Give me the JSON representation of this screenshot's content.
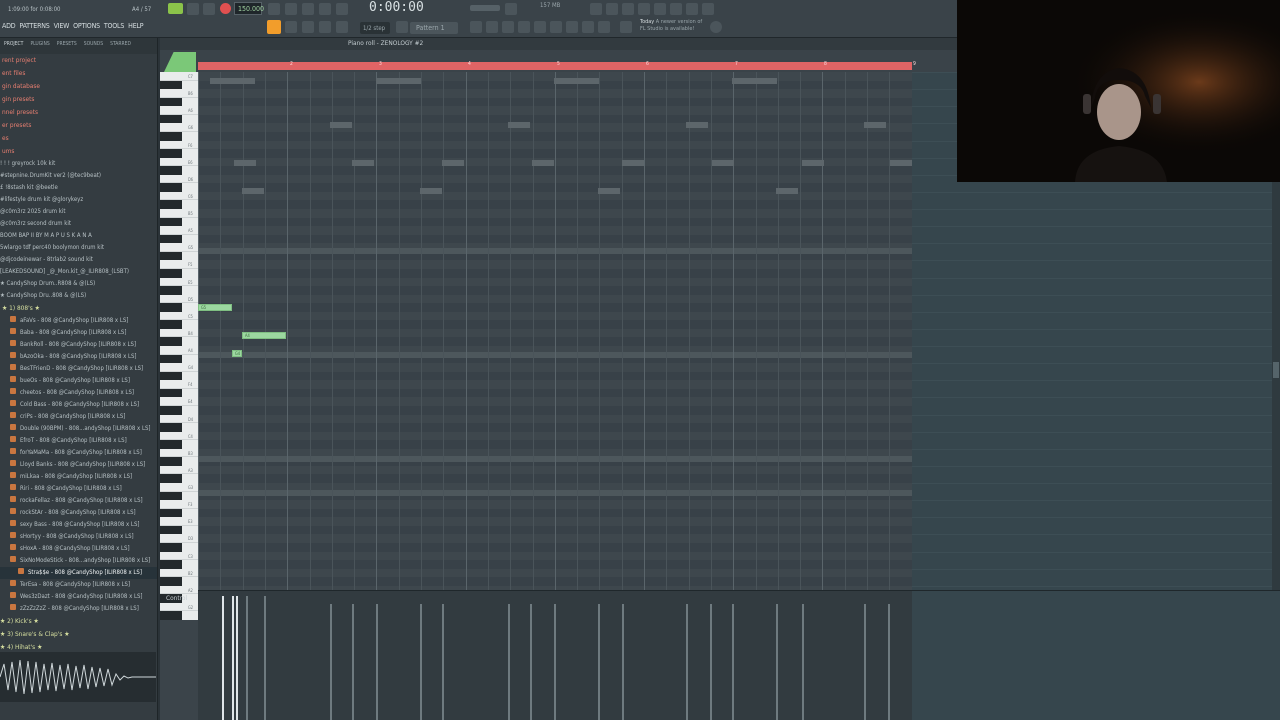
{
  "toolbar": {
    "hint_left": "1:09:00 for 0:08:00",
    "hint_right": "A4 / 57",
    "tempo": "150.000",
    "time": "0:00:00",
    "menu": [
      "ADD",
      "PATTERNS",
      "VIEW",
      "OPTIONS",
      "TOOLS",
      "HELP"
    ],
    "step": "1/2 step",
    "pattern": "Pattern 1",
    "cpu": "157 MB",
    "news_day": "Today",
    "news_text": "A newer version of",
    "news_text2": "FL Studio is available!"
  },
  "browser": {
    "tabs": [
      "PROJECT",
      "PLUGINS",
      "PRESETS",
      "SOUNDS",
      "STARRED"
    ],
    "top_items": [
      "rent project",
      "ent files",
      "gin database",
      "gin presets",
      "nnel presets",
      "er presets",
      "es"
    ],
    "section": "ums",
    "kits": [
      "! ! ! greyrock 10k kit",
      "#stepnine.DrumKit ver2 (@tec9beat)",
      "£ !8stash kit @beetle",
      "#lifestyle drum kit @glorykeyz",
      "@c0m3rz 2025 drum kit",
      "@c0m3rz second drum kit",
      "BOOM BAP II BY M A P U S K A N A",
      "5wlargo tdf perc40 boolymon drum kit",
      "@djcodeinewar - 8trlab2 sound kit",
      "[LEAKEDSOUND] _@_Mon.kit_@_ILIR808_(LSBT)"
    ],
    "candy_folders": [
      "★ CandyShop Drum..R808 & @(LS)",
      "★ CandyShop Dru..808 & @(LS)"
    ],
    "folder_808": "★ 1) 808's ★",
    "samples": [
      "aFaVs - 808 @CandyShop [ILIR808 x LS]",
      "Baba - 808 @CandyShop [ILIR808 x LS]",
      "BankRoll - 808 @CandyShop [ILIR808 x LS]",
      "bAzoOka - 808 @CandyShop [ILIR808 x LS]",
      "BesTFrienD - 808 @CandyShop [ILIR808 x LS]",
      "bueOs - 808 @CandyShop [ILIR808 x LS]",
      "cheetos - 808 @CandyShop [ILIR808 x LS]",
      "Cold Bass - 808 @CandyShop [ILIR808 x LS]",
      "criPs - 808 @CandyShop [ILIR808 x LS]",
      "Double (90BPM) - 808...andyShop [ILIR808 x LS]",
      "EfroT - 808 @CandyShop [ILIR808 x LS]",
      "forYaMaMa - 808 @CandyShop [ILIR808 x LS]",
      "Lloyd Banks - 808 @CandyShop [ILIR808 x LS]",
      "miLkaa - 808 @CandyShop [ILIR808 x LS]",
      "Riri - 808 @CandyShop [ILIR808 x LS]",
      "rockaFellaz - 808 @CandyShop [ILIR808 x LS]",
      "rockStAr - 808 @CandyShop [ILIR808 x LS]",
      "sexy Bass - 808 @CandyShop [ILIR808 x LS]",
      "sHortyy - 808 @CandyShop [ILIR808 x LS]",
      "sHoxA - 808 @CandyShop [ILIR808 x LS]",
      "SixNoModeStick - 808...andyShop [ILIR808 x LS]",
      "Stra$$e - 808 @CandyShop [ILIR808 x LS]",
      "TerEsa - 808 @CandyShop [ILIR808 x LS]",
      "Wes3zDazt - 808 @CandyShop [ILIR808 x LS]",
      "zZzZzZzZ - 808 @CandyShop [ILIR808 x LS]"
    ],
    "selected_sample_index": 21,
    "folder_kicks": "★ 2) Kick's ★",
    "folder_snares": "★ 3) Snare's & Clap's ★",
    "folder_hihats": "★ 4) Hihat's ★"
  },
  "piano_roll": {
    "title": "Piano roll - ZENOLOGY #2",
    "bars": [
      "2",
      "3",
      "4",
      "5",
      "6",
      "7",
      "8",
      "9"
    ],
    "key_labels": [
      "C7",
      "B6",
      "A6",
      "G6",
      "F6",
      "E6",
      "D6",
      "C6",
      "B5",
      "A5",
      "G5",
      "F5",
      "E5",
      "D5",
      "C5",
      "B4",
      "A4",
      "G4",
      "F4",
      "E4",
      "D4",
      "C4",
      "B3",
      "A3",
      "G3",
      "F3",
      "E3",
      "D3",
      "C3",
      "B2",
      "A2",
      "G2"
    ],
    "notes": [
      {
        "label": "G5"
      },
      {
        "label": "A4"
      },
      {
        "label": "G4"
      }
    ],
    "control_label": "Control"
  },
  "colors": {
    "accent_green": "#8bc34a",
    "note_green": "#9cd8a0",
    "timeline_red": "#e06465",
    "record_red": "#e05050",
    "orange": "#f29d2b"
  }
}
